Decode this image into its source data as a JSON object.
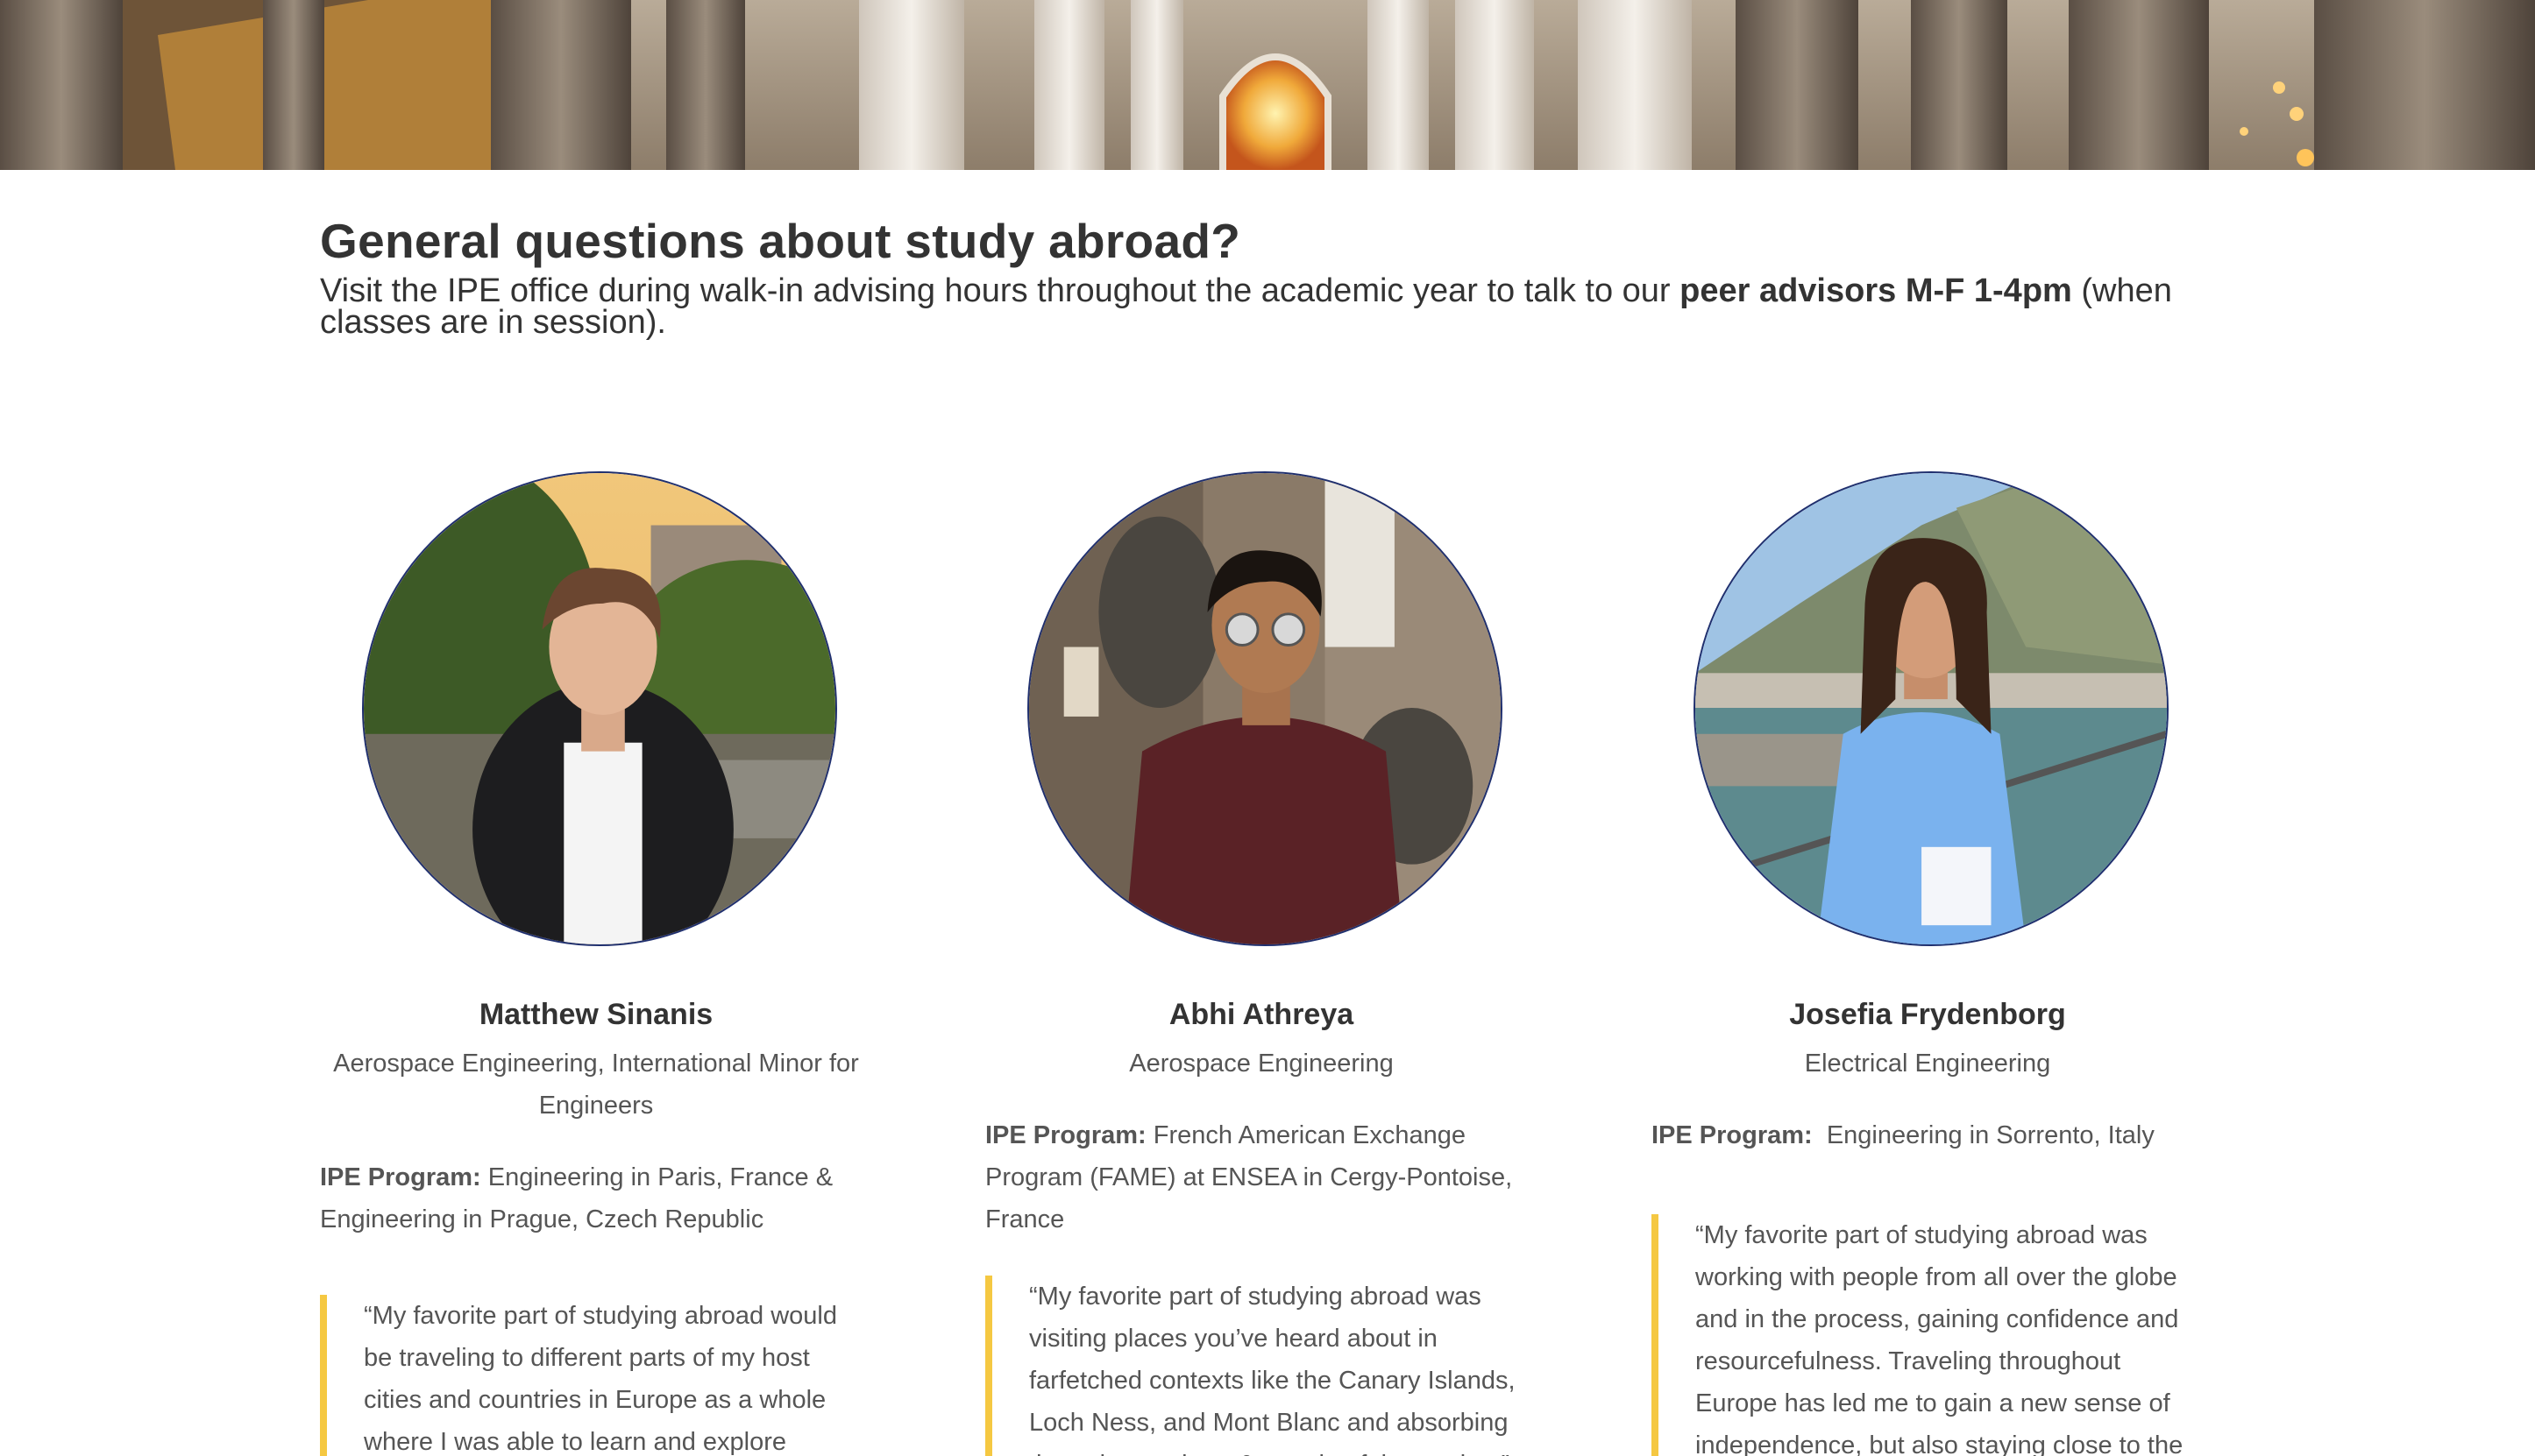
{
  "banner": {
    "image_name": "cathedral-interior-image"
  },
  "intro": {
    "heading": "General questions about study abroad?",
    "text_before": "Visit the IPE office during walk-in advising hours throughout the academic year to talk to our ",
    "text_bold": "peer advisors M-F 1-4pm",
    "text_after": " (when classes are in session)."
  },
  "advisors": [
    {
      "name": "Matthew Sinanis",
      "major": "Aerospace Engineering, International Minor for Engineers",
      "program_label": "IPE Program:",
      "program": " Engineering in Paris, France & Engineering in Prague, Czech Republic",
      "quote": "“My favorite part of studying abroad would be traveling to different parts of my host cities and countries in Europe as a whole where I was able to learn and explore"
    },
    {
      "name": "Abhi Athreya",
      "major": "Aerospace Engineering",
      "program_label": "IPE Program:",
      "program": " French American Exchange Program (FAME) at ENSEA in Cergy-Pontoise, France",
      "quote": "“My favorite part of studying abroad was visiting places you’ve heard about in farfetched contexts like the Canary Islands, Loch Ness, and Mont Blanc and absorbing the unique culture & people of that region.”"
    },
    {
      "name": "Josefia Frydenborg",
      "major": "Electrical Engineering",
      "program_label": "IPE Program:",
      "program": "  Engineering in Sorrento, Italy",
      "quote": "“My favorite part of studying abroad was working with people from all over the globe and in the process, gaining confidence and resourcefulness. Traveling throughout Europe has led me to gain a new sense of independence, but also staying close to the"
    }
  ],
  "colors": {
    "quote_bar": "#f5c842",
    "photo_border": "#1f2f6e",
    "heading": "#333333",
    "body": "#555555"
  }
}
